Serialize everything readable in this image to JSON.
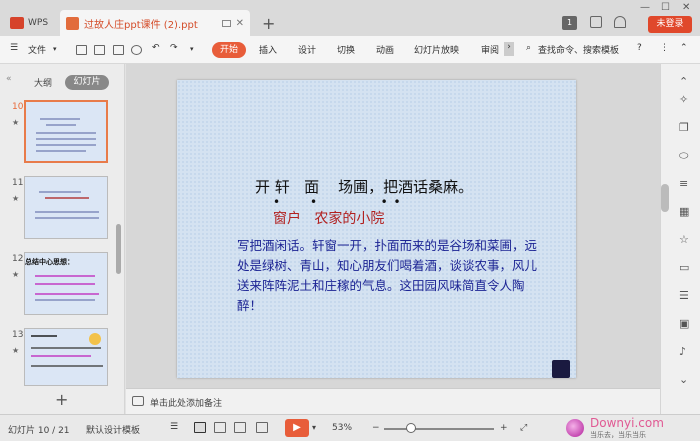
{
  "titlebar": {
    "app_tab": "WPS",
    "doc_tab": "过故人庄ppt课件 (2).ppt",
    "login_btn": "未登录",
    "badge": "1"
  },
  "menubar": {
    "file": "文件",
    "tabs": [
      "开始",
      "插入",
      "设计",
      "切换",
      "动画",
      "幻灯片放映",
      "审阅"
    ],
    "search": "查找命令、搜索模板",
    "help": "?"
  },
  "sidebar": {
    "outline_tab": "大纲",
    "slides_tab": "幻灯片",
    "thumbnails": [
      {
        "num": "10",
        "active": true
      },
      {
        "num": "11",
        "active": false
      },
      {
        "num": "12",
        "active": false,
        "title": "总结中心思想："
      },
      {
        "num": "13",
        "active": false
      }
    ]
  },
  "slide": {
    "title": "开 轩   面    场圃，把酒话桑麻。",
    "dots": "•      •             • •",
    "subtitle": "窗户   农家的小院",
    "body": "写把酒闲话。轩窗一开，扑面而来的是谷场和菜圃，远处是绿树、青山，知心朋友们喝着酒，谈谈农事，风儿送来阵阵泥土和庄稼的气息。这田园风味简直令人陶醉！"
  },
  "notes": {
    "placeholder": "单击此处添加备注"
  },
  "statusbar": {
    "slide_info": "幻灯片 10 / 21",
    "template": "默认设计模板",
    "zoom": "53%",
    "zoom_minus": "−",
    "zoom_plus": "+"
  },
  "watermark": {
    "site": "Downyi.com",
    "sub": "当乐去，当乐当乐"
  },
  "colors": {
    "accent": "#e85d3a",
    "slide_bg": "#d4e2f1",
    "body_text": "#1c2494",
    "subtitle": "#b2201f"
  }
}
